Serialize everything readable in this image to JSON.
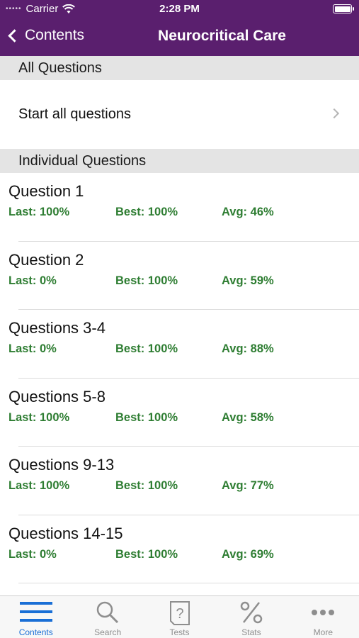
{
  "status": {
    "carrier": "Carrier",
    "time": "2:28 PM",
    "dots": "•••••"
  },
  "nav": {
    "back_label": "Contents",
    "title": "Neurocritical Care"
  },
  "sections": {
    "all": "All Questions",
    "individual": "Individual Questions"
  },
  "start_all": "Start all questions",
  "questions": [
    {
      "title": "Question 1",
      "last": "Last: 100%",
      "best": "Best: 100%",
      "avg": "Avg: 46%"
    },
    {
      "title": "Question 2",
      "last": "Last: 0%",
      "best": "Best: 100%",
      "avg": "Avg: 59%"
    },
    {
      "title": "Questions 3-4",
      "last": "Last: 0%",
      "best": "Best: 100%",
      "avg": "Avg: 88%"
    },
    {
      "title": "Questions 5-8",
      "last": "Last: 100%",
      "best": "Best: 100%",
      "avg": "Avg: 58%"
    },
    {
      "title": "Questions 9-13",
      "last": "Last: 100%",
      "best": "Best: 100%",
      "avg": "Avg: 77%"
    },
    {
      "title": "Questions 14-15",
      "last": "Last: 0%",
      "best": "Best: 100%",
      "avg": "Avg: 69%"
    }
  ],
  "tabs": [
    {
      "label": "Contents",
      "icon": "list-icon",
      "active": true
    },
    {
      "label": "Search",
      "icon": "search-icon",
      "active": false
    },
    {
      "label": "Tests",
      "icon": "tests-icon",
      "active": false
    },
    {
      "label": "Stats",
      "icon": "percent-icon",
      "active": false
    },
    {
      "label": "More",
      "icon": "more-icon",
      "active": false
    }
  ],
  "colors": {
    "nav": "#5a1f6e",
    "stat_green": "#2e7d32",
    "active_tab": "#1a6fd6"
  }
}
